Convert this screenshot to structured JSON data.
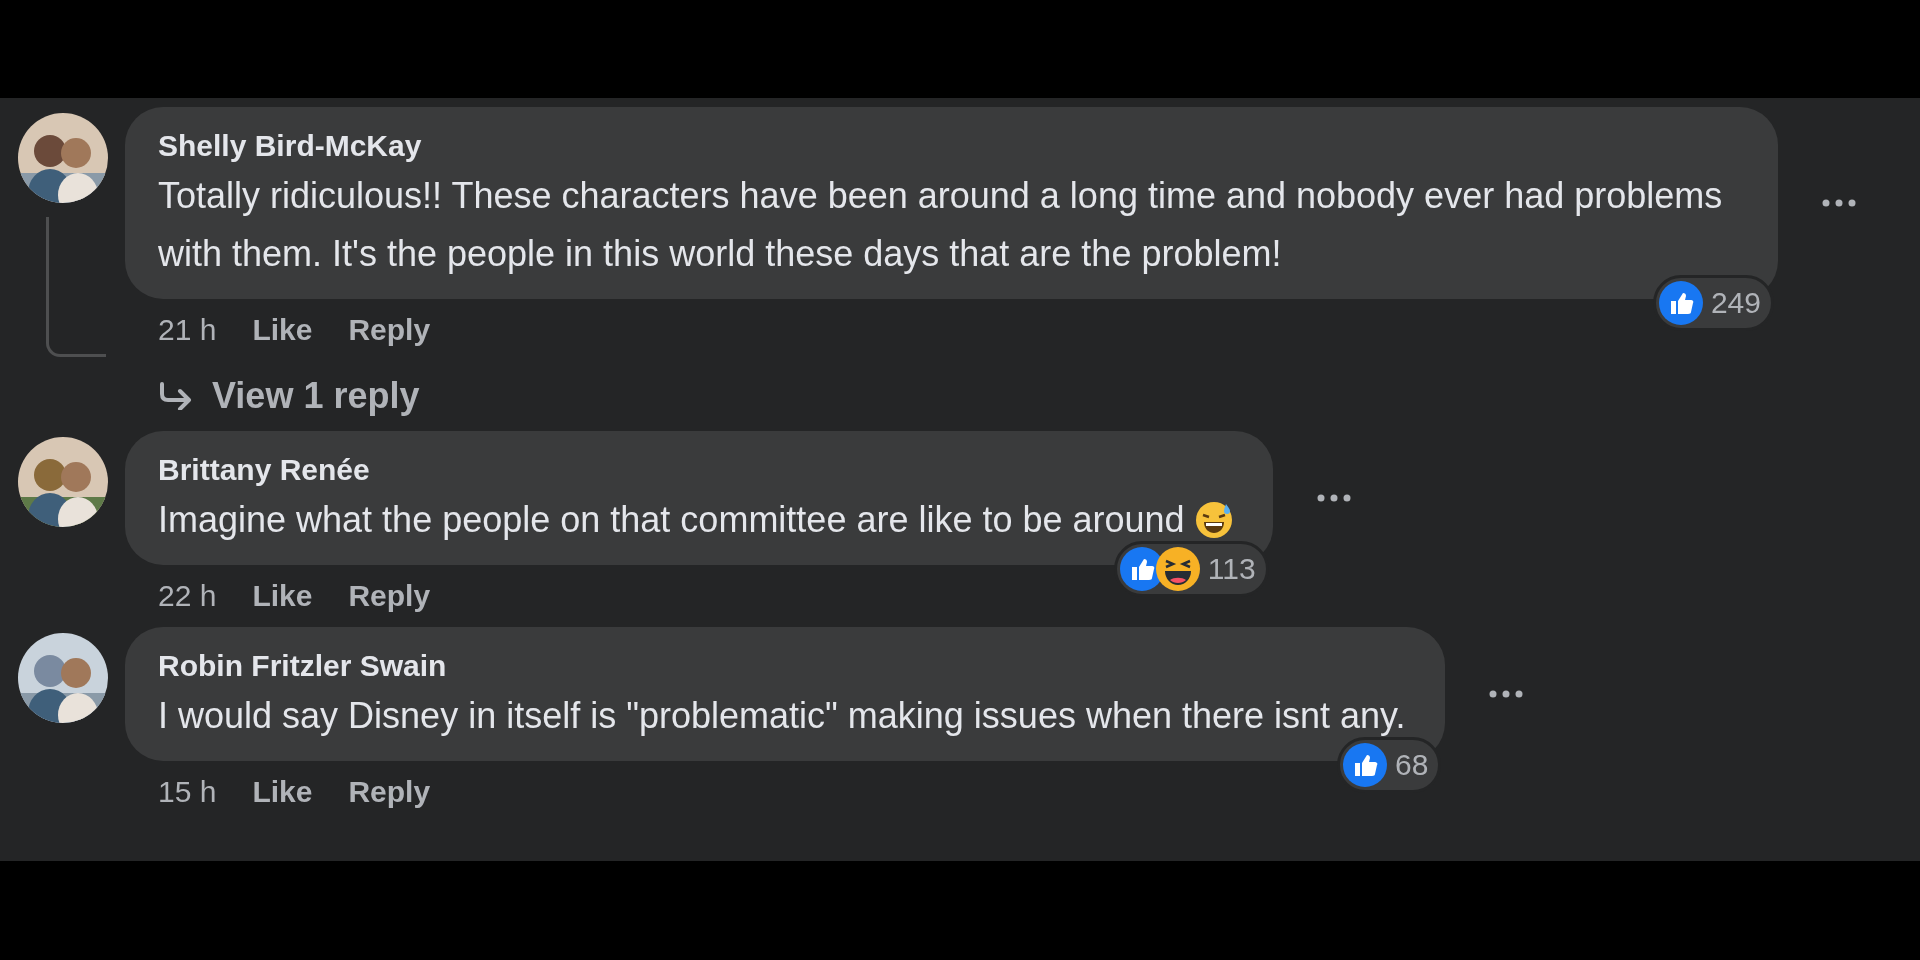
{
  "comments": [
    {
      "author": "Shelly Bird-McKay",
      "text": "Totally ridiculous!! These characters have been around a long time and nobody ever had problems with them. It's the people in this world these days that are the problem!",
      "trailing_emoji": false,
      "time": "21 h",
      "actions": [
        "Like",
        "Reply"
      ],
      "reactions": [
        {
          "kind": "like"
        }
      ],
      "reaction_count": "249",
      "replies_link": "View 1 reply"
    },
    {
      "author": "Brittany Renée",
      "text": "Imagine what the people on that committee are like to be around",
      "trailing_emoji": true,
      "time": "22 h",
      "actions": [
        "Like",
        "Reply"
      ],
      "reactions": [
        {
          "kind": "like"
        },
        {
          "kind": "haha"
        }
      ],
      "reaction_count": "113"
    },
    {
      "author": "Robin Fritzler Swain",
      "text": "I would say Disney in itself is \"problematic\" making issues when there isnt any.",
      "trailing_emoji": false,
      "time": "15 h",
      "actions": [
        "Like",
        "Reply"
      ],
      "reactions": [
        {
          "kind": "like"
        }
      ],
      "reaction_count": "68"
    }
  ]
}
